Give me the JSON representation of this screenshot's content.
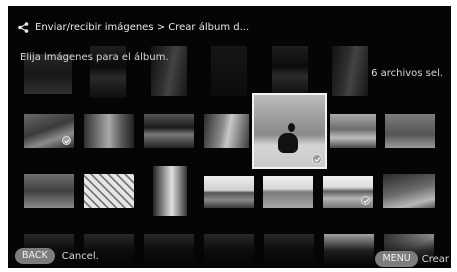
{
  "header": {
    "breadcrumb": "Enviar/recibir imágenes > Crear álbum d...",
    "icon": "share-icon"
  },
  "prompt": "Elija imágenes para el álbum.",
  "selection_count": "6 archivos sel.",
  "footer": {
    "back_key": "BACK",
    "back_label": "Cancel.",
    "menu_key": "MENU",
    "menu_label": "Crear"
  },
  "colors": {
    "background": "#050505",
    "pill": "#7d7d7d",
    "text": "#e8e8e8"
  }
}
